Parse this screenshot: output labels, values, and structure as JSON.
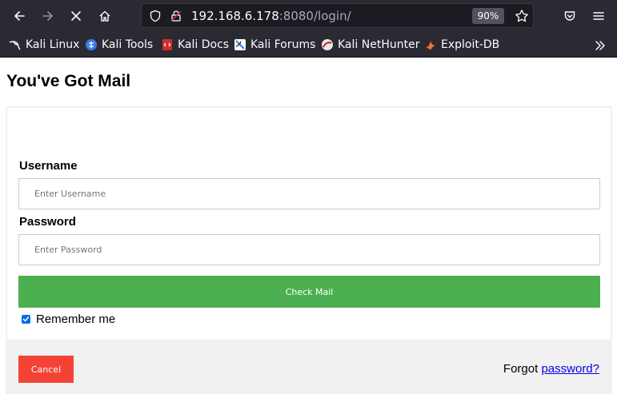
{
  "browser": {
    "url_host": "192.168.6.178",
    "url_rest": ":8080/login/",
    "zoom": "90%",
    "bookmarks": [
      {
        "label": "Kali Linux"
      },
      {
        "label": "Kali Tools"
      },
      {
        "label": "Kali Docs"
      },
      {
        "label": "Kali Forums"
      },
      {
        "label": "Kali NetHunter"
      },
      {
        "label": "Exploit-DB"
      }
    ]
  },
  "page": {
    "title": "You've Got Mail",
    "form": {
      "username_label": "Username",
      "username_placeholder": "Enter Username",
      "password_label": "Password",
      "password_placeholder": "Enter Password",
      "submit_label": "Check Mail",
      "remember_label": "Remember me",
      "remember_checked": true,
      "cancel_label": "Cancel",
      "forgot_prefix": "Forgot",
      "forgot_link": "password?"
    }
  },
  "colors": {
    "toolbar_bg": "#2b2a33",
    "submit_green": "#4caf50",
    "cancel_red": "#f44336",
    "link_blue": "#0000ee"
  }
}
